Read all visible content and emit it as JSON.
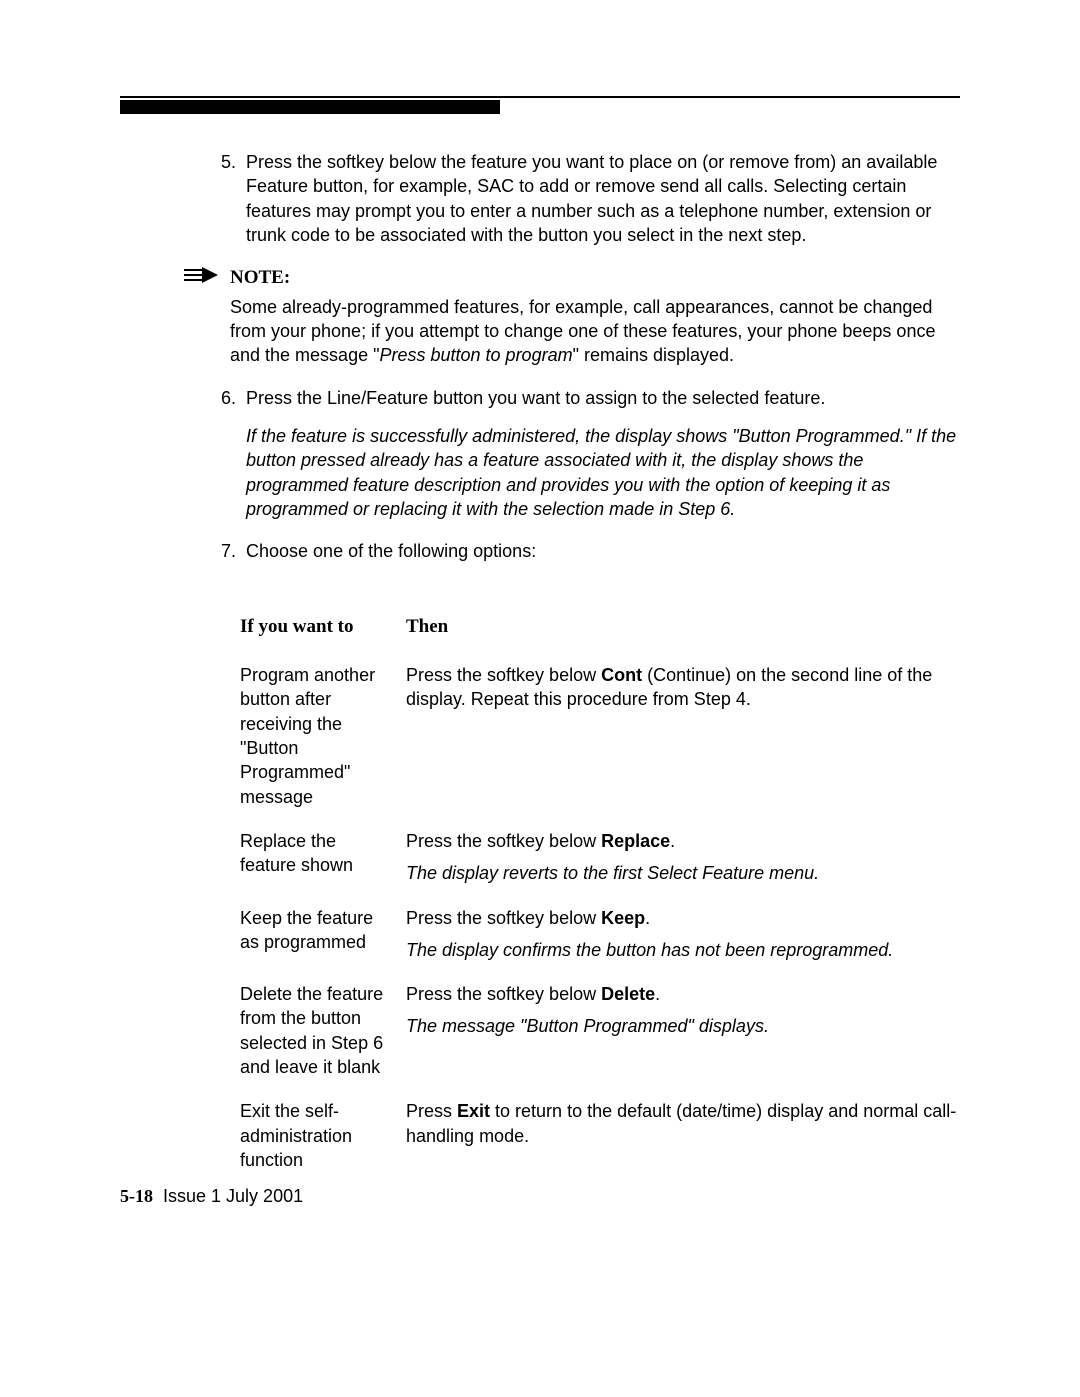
{
  "step5": {
    "num": "5.",
    "text": "Press the softkey below the feature you want to place on (or remove from) an available Feature button, for example, SAC to add or remove send all calls. Selecting certain features may prompt you to enter a number such as a telephone number, extension or trunk code to be associated with the button you select in the next step."
  },
  "note": {
    "label": "NOTE:",
    "body_pre": "Some already-programmed features, for example, call appearances, cannot be changed from your phone; if you attempt to change one of these features, your phone beeps once and the message \"",
    "body_italic": "Press button to program",
    "body_post": "\" remains displayed."
  },
  "step6": {
    "num": "6.",
    "text": "Press the Line/Feature button you want to assign to the selected feature.",
    "result": "If the feature is successfully administered, the display shows \"Button Programmed.\" If the button pressed already has a feature associated with it, the display shows the programmed feature description and provides you with the option of keeping it as programmed or replacing it with the selection made in Step 6."
  },
  "step7": {
    "num": "7.",
    "text": "Choose one of the following options:"
  },
  "table": {
    "head_if": "If you want to",
    "head_then": "Then",
    "rows": [
      {
        "if": "Program another button after receiving the \"Button Programmed\" message",
        "then_pre": "Press the softkey below ",
        "then_bold": "Cont",
        "then_post": " (Continue) on the second line of the display. Repeat this procedure from Step 4.",
        "result": ""
      },
      {
        "if": "Replace the feature shown",
        "then_pre": "Press the softkey below ",
        "then_bold": "Replace",
        "then_post": ".",
        "result": "The display reverts to the first Select Feature menu."
      },
      {
        "if": "Keep the feature as programmed",
        "then_pre": "Press the softkey below ",
        "then_bold": "Keep",
        "then_post": ".",
        "result": "The display confirms the button has not been reprogrammed."
      },
      {
        "if": "Delete the feature from the button selected in Step 6 and leave it blank",
        "then_pre": "Press the softkey below ",
        "then_bold": "Delete",
        "then_post": ".",
        "result": "The message \"Button Programmed\" displays."
      },
      {
        "if": "Exit the self-adminis­tration function",
        "then_pre": "Press ",
        "then_bold": "Exit",
        "then_post": " to return to the default (date/time) display and normal call-handling mode.",
        "result": ""
      }
    ]
  },
  "footer": {
    "page": "5-18",
    "issue": "Issue  1   July 2001"
  }
}
